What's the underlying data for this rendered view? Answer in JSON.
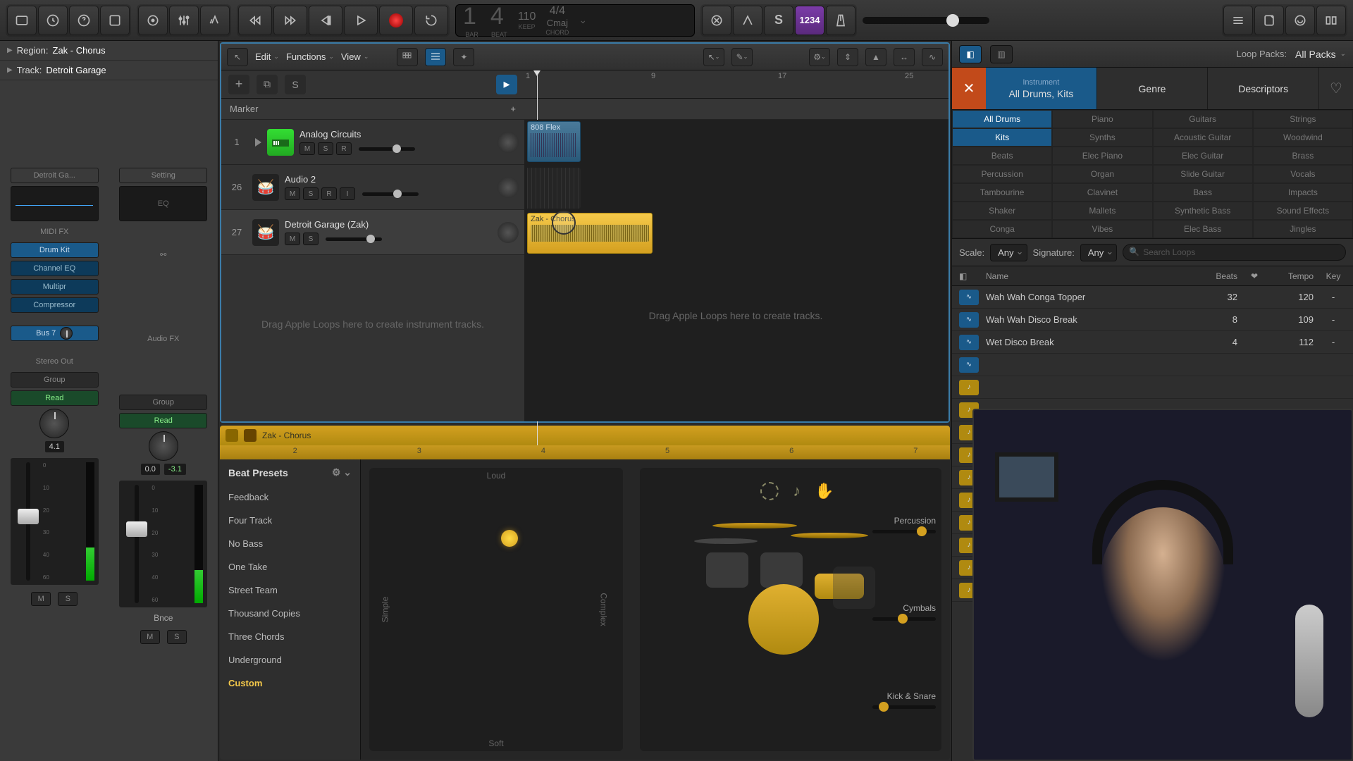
{
  "lcd": {
    "bar": "1",
    "beat": "4",
    "bar_label": "BAR",
    "beat_label": "BEAT",
    "tempo": "110",
    "keep": "KEEP",
    "sig": "4/4",
    "key": "Cmaj",
    "chord": "CHORD"
  },
  "count": "1234",
  "inspector": {
    "region_label": "Region:",
    "region_name": "Zak - Chorus",
    "track_label": "Track:",
    "track_name": "Detroit Garage"
  },
  "strip1": {
    "name": "Detroit Ga...",
    "midi_fx": "MIDI FX",
    "instrument": "Drum Kit",
    "fx1": "Channel EQ",
    "fx2": "Multipr",
    "fx3": "Compressor",
    "send": "Bus 7",
    "output": "Stereo Out",
    "group": "Group",
    "auto": "Read",
    "db": "4.1"
  },
  "strip2": {
    "name": "Setting",
    "eq": "EQ",
    "audio_fx": "Audio FX",
    "group": "Group",
    "auto": "Read",
    "db": "0.0",
    "peak": "-3.1",
    "bnce": "Bnce"
  },
  "ms": {
    "m": "M",
    "s": "S"
  },
  "arr": {
    "edit": "Edit",
    "functions": "Functions",
    "view": "View",
    "marker": "Marker",
    "bars": [
      "1",
      "9",
      "17",
      "25"
    ],
    "drop1": "Drag Apple Loops here to create instrument tracks.",
    "drop2": "Drag Apple Loops here to create tracks."
  },
  "tracks": [
    {
      "num": "1",
      "name": "Analog Circuits",
      "btns": [
        "M",
        "S",
        "R"
      ],
      "icon": "synth"
    },
    {
      "num": "26",
      "name": "Audio 2",
      "btns": [
        "M",
        "S",
        "R",
        "I"
      ],
      "icon": "drums"
    },
    {
      "num": "27",
      "name": "Detroit Garage (Zak)",
      "btns": [
        "M",
        "S"
      ],
      "icon": "drummer"
    }
  ],
  "regions": {
    "blue": "808 Flex",
    "yellow": "Zak - Chorus"
  },
  "drummer": {
    "title": "Zak - Chorus",
    "ruler": [
      "2",
      "3",
      "4",
      "5",
      "6",
      "7"
    ],
    "presets_label": "Beat Presets",
    "presets": [
      "Feedback",
      "Four Track",
      "No Bass",
      "One Take",
      "Street Team",
      "Thousand Copies",
      "Three Chords",
      "Underground",
      "Custom"
    ],
    "xy": {
      "loud": "Loud",
      "soft": "Soft",
      "simple": "Simple",
      "complex": "Complex"
    },
    "sliders": {
      "percussion": "Percussion",
      "cymbals": "Cymbals",
      "kicksnare": "Kick & Snare"
    }
  },
  "loops": {
    "packs_label": "Loop Packs:",
    "packs_value": "All Packs",
    "tabs": {
      "inst_top": "Instrument",
      "inst_bot": "All Drums, Kits",
      "genre": "Genre",
      "desc": "Descriptors"
    },
    "tags_active": [
      "All Drums",
      "Kits"
    ],
    "tags": [
      "Piano",
      "Guitars",
      "Strings",
      "Synths",
      "Acoustic Guitar",
      "Woodwind",
      "Beats",
      "Elec Piano",
      "Elec Guitar",
      "Brass",
      "Percussion",
      "Organ",
      "Slide Guitar",
      "Vocals",
      "Tambourine",
      "Clavinet",
      "Bass",
      "Impacts",
      "Shaker",
      "Mallets",
      "Synthetic Bass",
      "Sound Effects",
      "Conga",
      "Vibes",
      "Elec Bass",
      "Jingles"
    ],
    "scale_label": "Scale:",
    "scale_value": "Any",
    "sig_label": "Signature:",
    "sig_value": "Any",
    "search_placeholder": "Search Loops",
    "cols": {
      "name": "Name",
      "beats": "Beats",
      "fav": "❤",
      "tempo": "Tempo",
      "key": "Key"
    },
    "items": [
      {
        "name": "Wah Wah Conga Topper",
        "beats": "32",
        "tempo": "120",
        "key": "-"
      },
      {
        "name": "Wah Wah Disco Break",
        "beats": "8",
        "tempo": "109",
        "key": "-"
      },
      {
        "name": "Wet Disco Break",
        "beats": "4",
        "tempo": "112",
        "key": "-"
      }
    ]
  }
}
